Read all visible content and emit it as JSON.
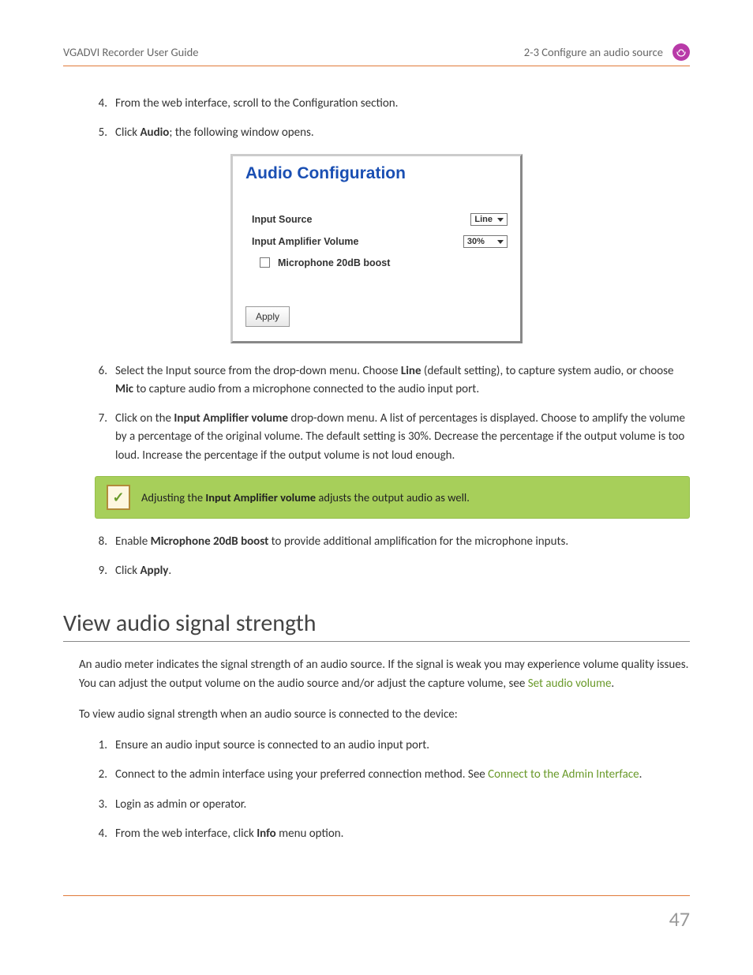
{
  "header": {
    "left": "VGADVI Recorder User Guide",
    "right": "2-3 Configure an audio source"
  },
  "steps_a": [
    {
      "n": "4.",
      "text": "From the web interface, scroll to the Configuration section."
    },
    {
      "n": "5.",
      "pre": "Click ",
      "b1": "Audio",
      "post": "; the following window opens."
    }
  ],
  "figure": {
    "title": "Audio Configuration",
    "row1_label": "Input Source",
    "row1_value": "Line",
    "row2_label": "Input Amplifier Volume",
    "row2_value": "30%",
    "check_label": "Microphone 20dB boost",
    "apply": "Apply"
  },
  "steps_b": [
    {
      "n": "6.",
      "pre": "Select the Input source from the drop-down menu. Choose ",
      "b1": "Line",
      "mid": " (default setting), to capture system audio, or choose ",
      "b2": "Mic",
      "post": " to capture audio from a microphone connected to the audio input port."
    },
    {
      "n": "7.",
      "pre": "Click on the ",
      "b1": "Input Amplifier volume",
      "post": " drop-down menu. A list of percentages is displayed. Choose to amplify the volume by a percentage of the original volume. The default setting is 30%. Decrease the percentage if the output volume is too loud. Increase the percentage if the output volume is not loud enough."
    }
  ],
  "callout": {
    "pre": "Adjusting the ",
    "b1": "Input Amplifier volume",
    "post": " adjusts the output audio as well."
  },
  "steps_c": [
    {
      "n": "8.",
      "pre": "Enable ",
      "b1": "Microphone 20dB boost",
      "post": " to provide additional amplification for the microphone inputs."
    },
    {
      "n": "9.",
      "pre": "Click ",
      "b1": "Apply",
      "post": "."
    }
  ],
  "section2": {
    "title": "View audio signal strength",
    "para1_pre": "An audio meter indicates the signal strength of an audio source. If the signal is weak you may experience volume quality issues. You can adjust the output volume on the audio source and/or adjust the capture volume, see ",
    "para1_link": "Set audio volume",
    "para1_post": ".",
    "para2": "To view audio signal strength when an audio source is connected to the device:",
    "steps": [
      {
        "n": "1.",
        "text": "Ensure an audio input source is connected to an audio input port."
      },
      {
        "n": "2.",
        "pre": "Connect to the admin interface using your preferred connection method. See ",
        "link": "Connect to the Admin Interface",
        "post": "."
      },
      {
        "n": "3.",
        "text": "Login as admin or operator."
      },
      {
        "n": "4.",
        "pre": "From the web interface, click ",
        "b1": "Info",
        "post": " menu option."
      }
    ]
  },
  "page": "47"
}
